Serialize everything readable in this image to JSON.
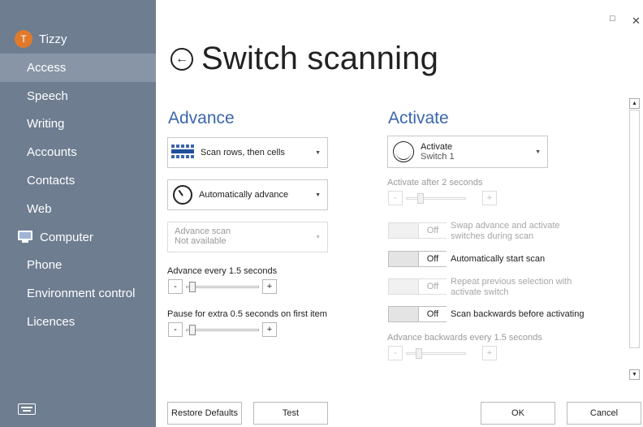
{
  "user": {
    "initial": "T",
    "name": "Tizzy"
  },
  "sidebar": {
    "items": [
      {
        "label": "Access"
      },
      {
        "label": "Speech"
      },
      {
        "label": "Writing"
      },
      {
        "label": "Accounts"
      },
      {
        "label": "Contacts"
      },
      {
        "label": "Web"
      },
      {
        "label": "Computer",
        "icon": "computer-icon"
      },
      {
        "label": "Phone"
      },
      {
        "label": "Environment control"
      },
      {
        "label": "Licences"
      }
    ],
    "active": "Access"
  },
  "window": {
    "maximize": "□",
    "close": "✕"
  },
  "page": {
    "title": "Switch scanning",
    "back_icon": "←"
  },
  "advance": {
    "heading": "Advance",
    "scan_mode": "Scan rows, then cells",
    "advance_mode": "Automatically advance",
    "advance_scan_title": "Advance scan",
    "advance_scan_sub": "Not available",
    "advance_every_label": "Advance every 1.5 seconds",
    "advance_every_value": 1.5,
    "pause_label": "Pause for extra 0.5 seconds on first item",
    "pause_value": 0.5
  },
  "activate": {
    "heading": "Activate",
    "switch_title": "Activate",
    "switch_sub": "Switch 1",
    "activate_after_label": "Activate after 2 seconds",
    "toggles": [
      {
        "state": "Off",
        "label_line1": "Swap advance and activate",
        "label_line2": "switches during scan"
      },
      {
        "state": "Off",
        "label_line1": "Automatically start scan",
        "label_line2": ""
      },
      {
        "state": "Off",
        "label_line1": "Repeat previous selection with",
        "label_line2": "activate switch"
      },
      {
        "state": "Off",
        "label_line1": "Scan backwards before activating",
        "label_line2": ""
      }
    ],
    "backwards_label": "Advance backwards every 1.5 seconds"
  },
  "slider_buttons": {
    "minus": "-",
    "plus": "+"
  },
  "footer": {
    "restore": "Restore Defaults",
    "test": "Test",
    "ok": "OK",
    "cancel": "Cancel"
  },
  "colors": {
    "sidebar": "#6e7d90",
    "active": "#8795a6",
    "accent": "#3b66ad",
    "avatar": "#e07a2a"
  }
}
